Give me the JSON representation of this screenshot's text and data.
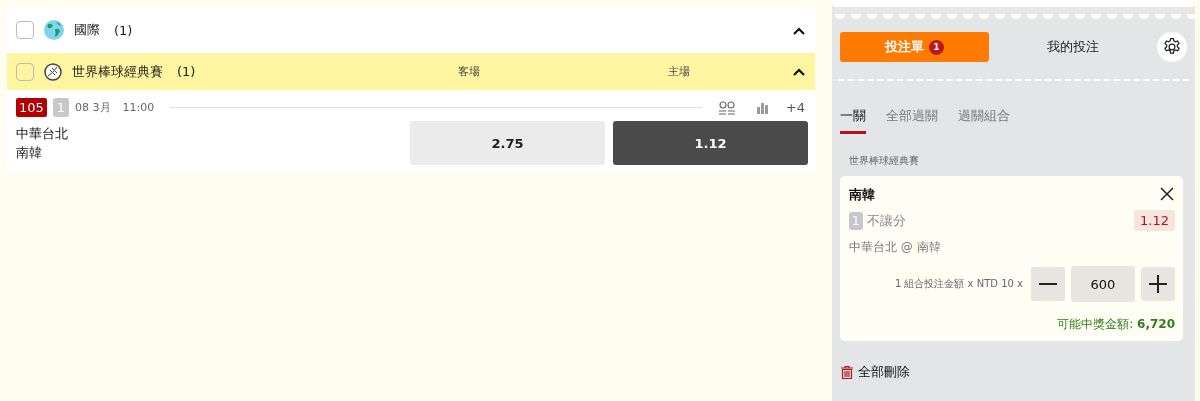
{
  "region": {
    "name": "國際",
    "count": "(1)",
    "checked": false,
    "expanded": true
  },
  "league": {
    "name": "世界棒球經典賽",
    "count": "(1)",
    "checked": false,
    "expanded": true,
    "columns": [
      "客場",
      "主場"
    ]
  },
  "match": {
    "number": "105",
    "badge": "1",
    "date": "08 3月",
    "time": "11:00",
    "more": "+4",
    "teams": [
      "中華台北",
      "南韓"
    ],
    "odds": [
      {
        "value": "2.75",
        "selected": false
      },
      {
        "value": "1.12",
        "selected": true
      }
    ]
  },
  "betslip": {
    "tabs": [
      {
        "label": "投注單",
        "count": "1",
        "selected": true
      },
      {
        "label": "我的投注",
        "selected": false
      }
    ],
    "modes": [
      {
        "label": "一關",
        "selected": true
      },
      {
        "label": "全部過關",
        "selected": false
      },
      {
        "label": "過關組合",
        "selected": false
      }
    ],
    "league": "世界棒球經典賽",
    "bet": {
      "selection": "南韓",
      "line_badge": "1",
      "market": "不讓分",
      "odds": "1.12",
      "match": "中華台北 @ 南韓",
      "stake_label": "1 組合投注金額 x NTD 10 x",
      "stake": "600",
      "payout_label": "可能中獎金額:",
      "payout": "6,720"
    },
    "delete_all": "全部刪除"
  }
}
